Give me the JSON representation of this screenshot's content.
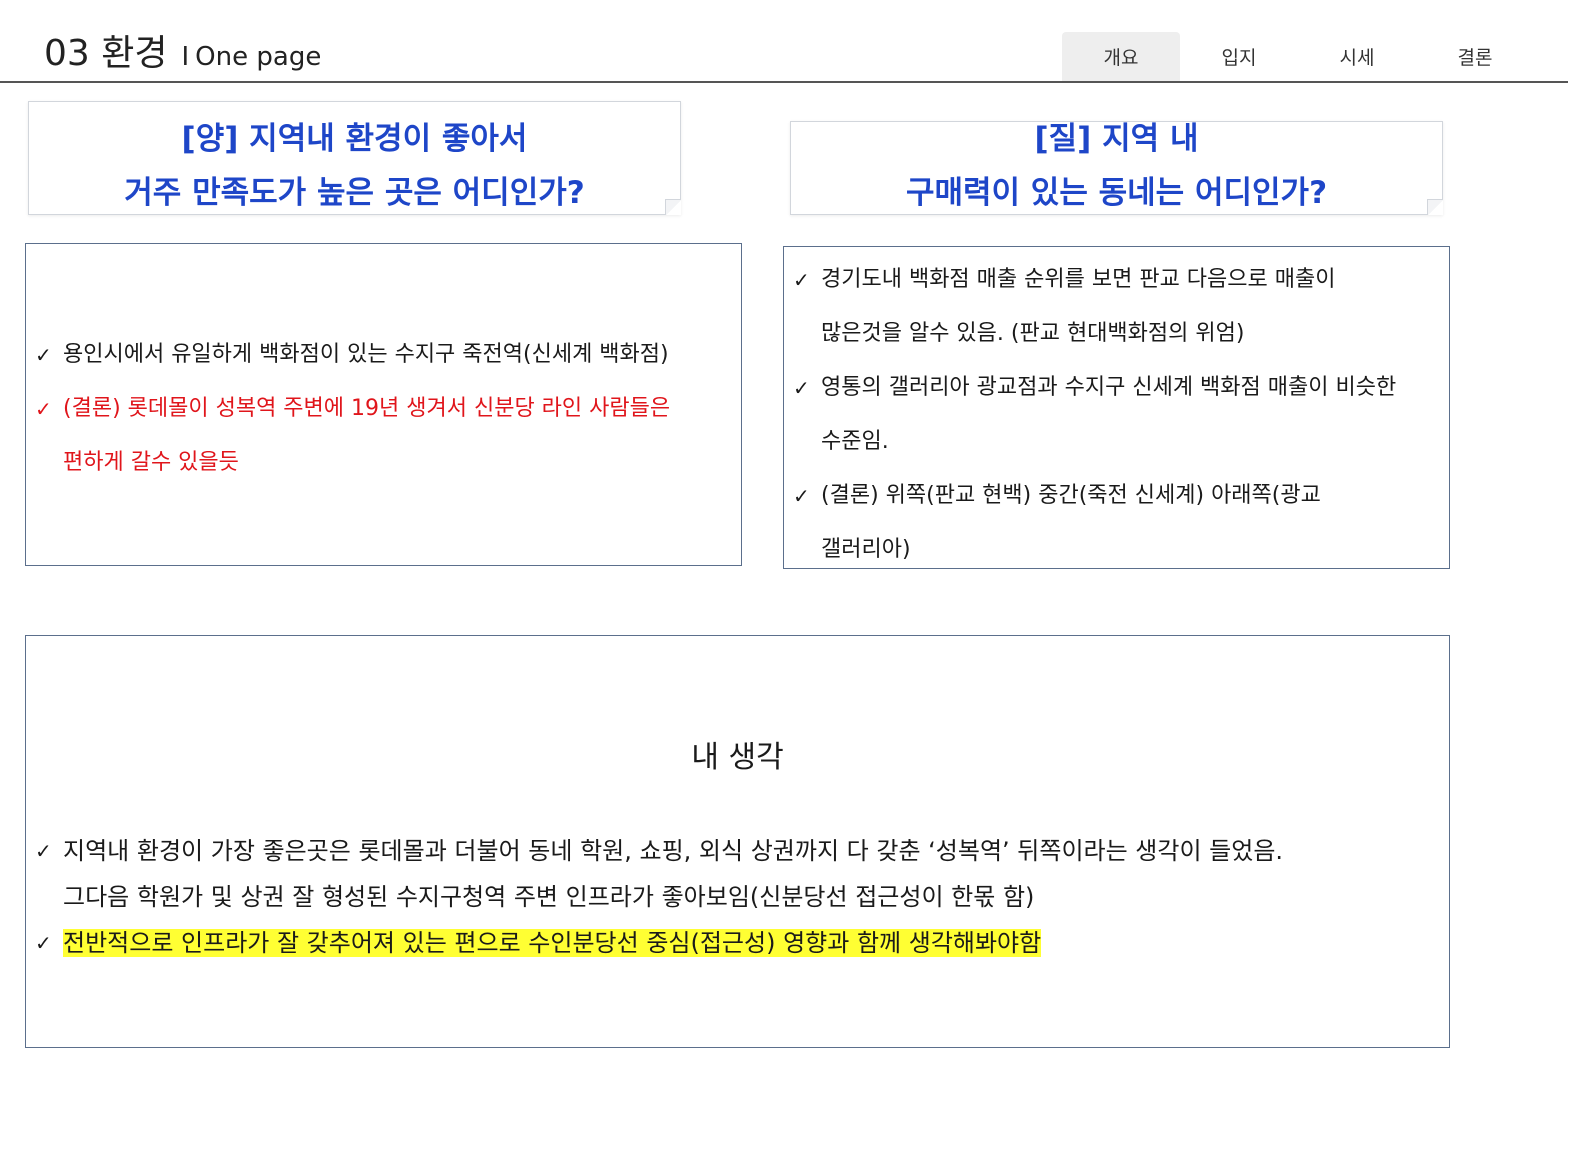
{
  "header": {
    "section_number": "03 환경",
    "separator": "I",
    "subtitle": "One page"
  },
  "tabs": [
    {
      "label": "개요",
      "active": true
    },
    {
      "label": "입지",
      "active": false
    },
    {
      "label": "시세",
      "active": false
    },
    {
      "label": "결론",
      "active": false
    }
  ],
  "question_left": {
    "line1": "[양] 지역내 환경이 좋아서",
    "line2": "거주 만족도가 높은 곳은 어디인가?"
  },
  "question_right": {
    "line1": "[질] 지역 내",
    "line2": "구매력이 있는 동네는 어디인가?"
  },
  "left_box": {
    "bullets": [
      {
        "lines": [
          "용인시에서 유일하게 백화점이 있는 수지구 죽전역(신세계 백화점)"
        ],
        "color": "black"
      },
      {
        "lines": [
          "(결론) 롯데몰이 성복역 주변에 19년 생겨서 신분당 라인 사람들은",
          "편하게 갈수 있을듯"
        ],
        "color": "red"
      }
    ]
  },
  "right_box": {
    "bullets": [
      {
        "lines": [
          "경기도내 백화점 매출 순위를 보면 판교 다음으로 매출이",
          "많은것을 알수 있음. (판교 현대백화점의 위엄)"
        ]
      },
      {
        "lines": [
          "영통의 갤러리아 광교점과 수지구 신세계 백화점 매출이 비슷한",
          "수준임."
        ]
      },
      {
        "lines": [
          "(결론) 위쪽(판교 현백) 중간(죽전 신세계) 아래쪽(광교",
          "갤러리아)"
        ]
      }
    ]
  },
  "opinion": {
    "title": "내 생각",
    "bullet1_line1": "지역내 환경이 가장 좋은곳은 롯데몰과 더불어 동네 학원, 쇼핑, 외식 상권까지 다 갖춘 ‘성복역’ 뒤쪽이라는 생각이 들었음.",
    "bullet1_line2": "그다음 학원가 및 상권 잘 형성된 수지구청역 주변 인프라가 좋아보임(신분당선 접근성이 한몫 함)",
    "bullet2_highlighted": "전반적으로 인프라가 잘 갖추어져 있는 편으로 수인분당선 중심(접근성) 영향과 함께 생각해봐야함"
  },
  "check_icon": "✓",
  "colors": {
    "question_text": "#1e46c8",
    "conclusion_red": "#e0151b",
    "highlight": "#ffff33",
    "box_border": "#5b6f8c"
  }
}
